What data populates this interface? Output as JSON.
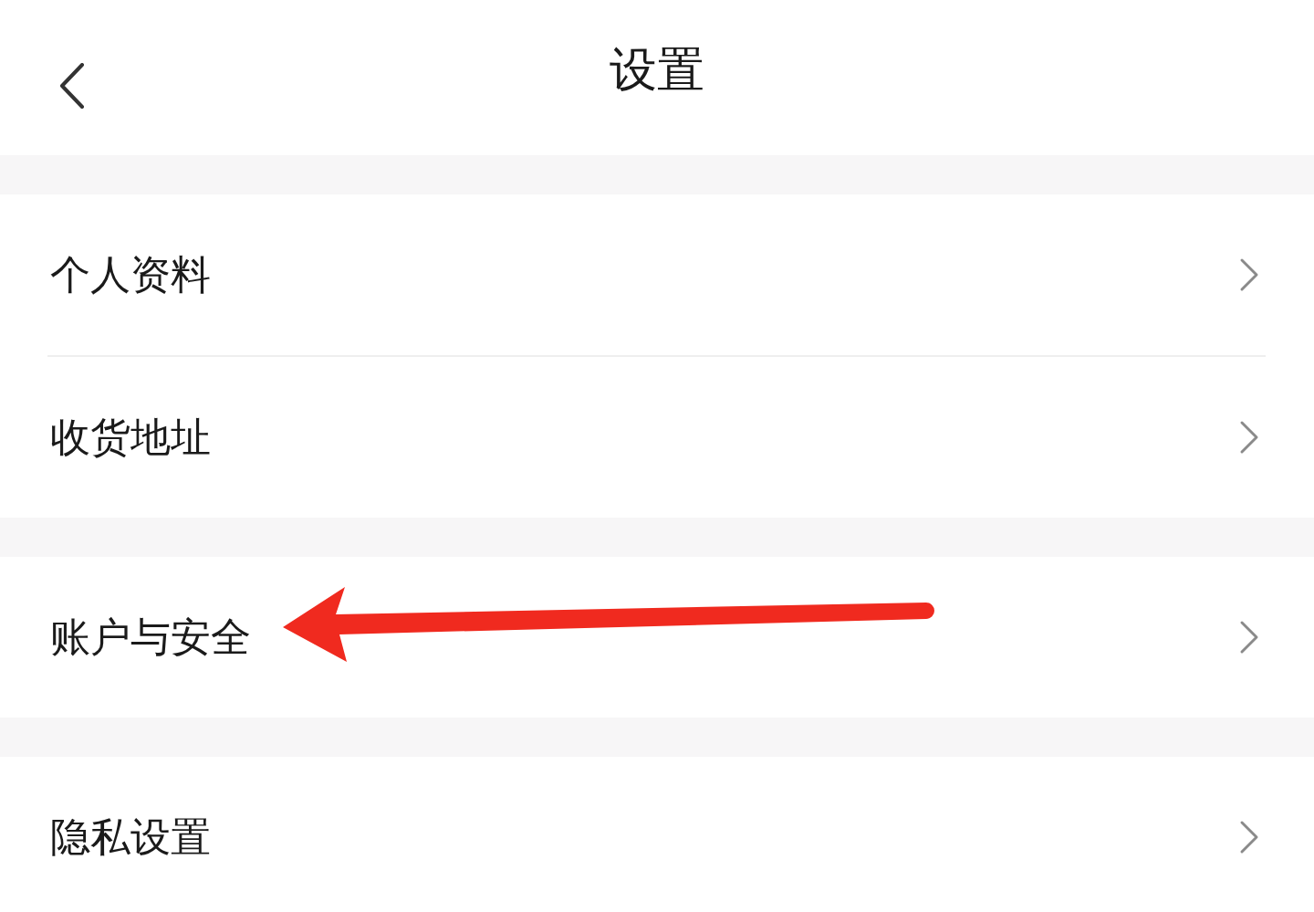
{
  "header": {
    "title": "设置"
  },
  "groups": [
    {
      "items": [
        {
          "label": "个人资料",
          "pointed": false
        },
        {
          "label": "收货地址",
          "pointed": false
        }
      ]
    },
    {
      "items": [
        {
          "label": "账户与安全",
          "pointed": true
        }
      ]
    },
    {
      "items": [
        {
          "label": "隐私设置",
          "pointed": false
        }
      ]
    }
  ]
}
